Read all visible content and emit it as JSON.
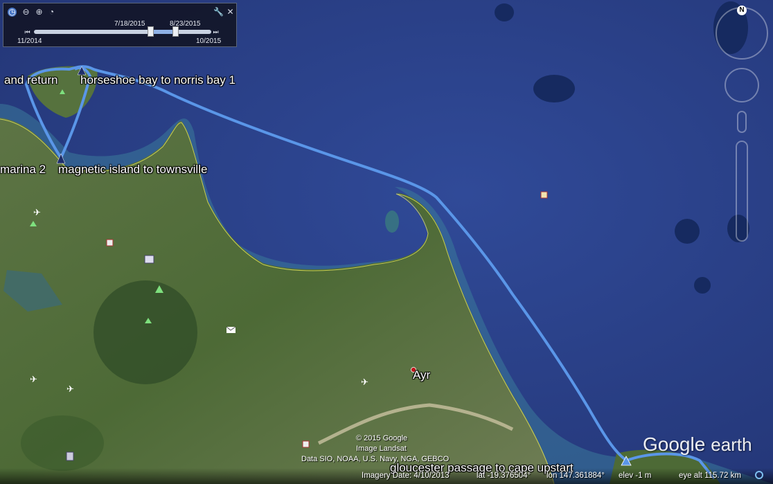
{
  "time_slider": {
    "range_start": "11/2014",
    "range_end": "10/2015",
    "window_start": "7/18/2015",
    "window_end": "8/23/2015"
  },
  "labels": {
    "track_1": "and return",
    "track_2": "horseshoe bay to norris bay 1",
    "track_3": "marina 2",
    "track_4": "magnetic island to townsville",
    "town": "Ayr",
    "track_5": "gloucester passage to cape upstart"
  },
  "attribution": {
    "line1": "© 2015 Google",
    "line2": "Image Landsat",
    "line3": "Data SIO, NOAA, U.S. Navy, NGA, GEBCO"
  },
  "logo": {
    "brand": "Google",
    "product": "earth"
  },
  "status": {
    "imagery_date": "Imagery Date: 4/10/2013",
    "lat": "lat  -19.376504°",
    "lon": "lon  147.361884°",
    "elev": "elev    -1 m",
    "eye_alt": "eye alt 115.72 km"
  },
  "nav": {
    "north_label": "N"
  },
  "colors": {
    "track": "#5a96e8",
    "sea": "#2d4390",
    "land": "#4c6a38"
  }
}
